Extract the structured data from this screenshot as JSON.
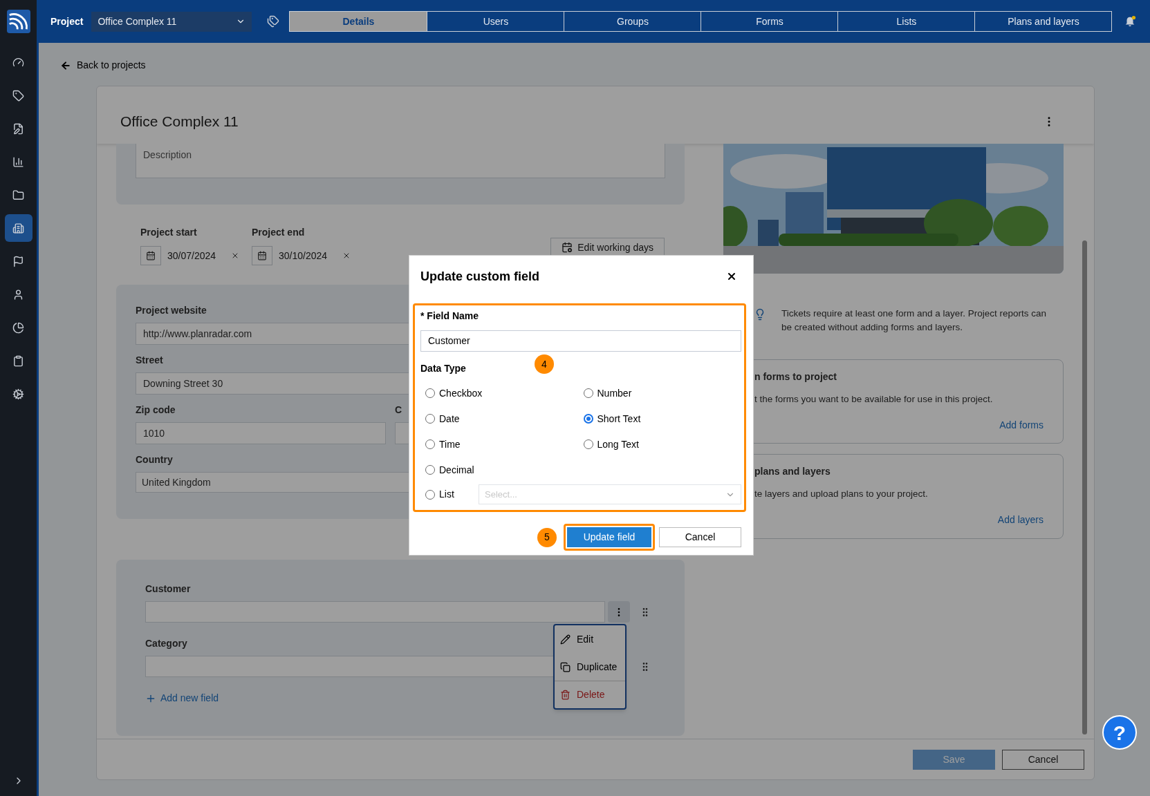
{
  "sidebar": {
    "items": [
      {
        "selected": false
      },
      {
        "selected": false
      },
      {
        "selected": false
      },
      {
        "selected": false
      },
      {
        "selected": false
      },
      {
        "selected": true
      },
      {
        "selected": false
      },
      {
        "selected": false
      },
      {
        "selected": false
      },
      {
        "selected": false
      },
      {
        "selected": false
      }
    ]
  },
  "top_bar": {
    "project_label": "Project",
    "project_select": "Office Complex 11",
    "tabs": [
      {
        "label": "Details",
        "selected": true
      },
      {
        "label": "Users",
        "selected": false
      },
      {
        "label": "Groups",
        "selected": false
      },
      {
        "label": "Forms",
        "selected": false
      },
      {
        "label": "Lists",
        "selected": false
      },
      {
        "label": "Plans and layers",
        "selected": false
      }
    ]
  },
  "back_link": "Back to projects",
  "project": {
    "title": "Office Complex 11"
  },
  "description": {
    "placeholder": "Description"
  },
  "dates": [
    {
      "label": "Project start",
      "value": "30/07/2024"
    },
    {
      "label": "Project end",
      "value": "30/10/2024"
    }
  ],
  "edit_working_days": "Edit working days",
  "address_fields": [
    {
      "label": "Project website",
      "value": "http://www.planradar.com"
    },
    {
      "label": "Street",
      "value": "Downing Street 30"
    },
    {
      "label": "Zip code",
      "value": "1010"
    },
    {
      "label": "C"
    },
    {
      "label": "Country",
      "value": "United Kingdom"
    }
  ],
  "custom_fields": [
    {
      "label": "Customer",
      "menu_open": true
    },
    {
      "label": "Category",
      "menu_open": false
    }
  ],
  "add_field": "Add new field",
  "context_menu": [
    {
      "label": "Edit",
      "kind": "edit"
    },
    {
      "label": "Duplicate",
      "kind": "duplicate"
    },
    {
      "label": "Delete",
      "kind": "delete"
    }
  ],
  "tip": "Tickets require at least one form and a layer. Project reports can be created without adding forms and layers.",
  "cards": [
    {
      "title": "n forms to project",
      "text": "t the forms you want to be available for use in this project.",
      "link": "Add forms"
    },
    {
      "title": "plans and layers",
      "text": "te layers and upload plans to your project.",
      "link": "Add layers"
    }
  ],
  "footer": {
    "save": {
      "label": "Save",
      "disabled": true
    },
    "cancel": "Cancel"
  },
  "help_button": "?",
  "modal": {
    "title": "Update custom field",
    "field_label": "* Field Name",
    "field_value": "Customer",
    "data_type_label": "Data Type",
    "options": [
      {
        "label": "Checkbox",
        "selected": false
      },
      {
        "label": "Number",
        "selected": false
      },
      {
        "label": "Date",
        "selected": false
      },
      {
        "label": "Short Text",
        "selected": true
      },
      {
        "label": "Time",
        "selected": false
      },
      {
        "label": "Long Text",
        "selected": false
      },
      {
        "label": "Decimal",
        "selected": false
      },
      {
        "label": "List",
        "selected": false
      }
    ],
    "list_select": {
      "placeholder": "Select..."
    },
    "primary": "Update field",
    "cancel": "Cancel",
    "callouts": [
      "4",
      "5"
    ]
  }
}
